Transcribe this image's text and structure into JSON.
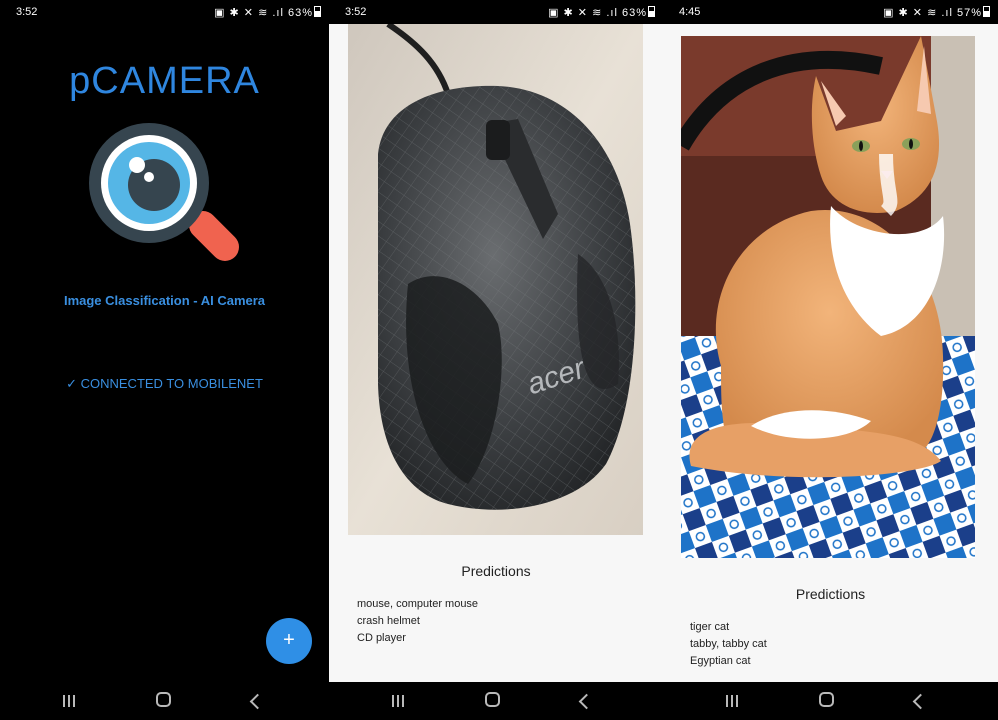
{
  "screens": [
    {
      "status": {
        "time": "3:52",
        "icons": "▣ ✱ ✕ ≋ .ıl",
        "battery": "63%"
      },
      "app_title": "pCAMERA",
      "subtitle": "Image Classification - AI Camera",
      "connected": "✓ CONNECTED TO MOBILENET",
      "fab_label": "+",
      "logo_icon": "magnifier-eye-icon",
      "colors": {
        "accent": "#2f86df",
        "lens": "#55b6e6",
        "handle": "#f0634f",
        "frame": "#36454f"
      }
    },
    {
      "status": {
        "time": "3:52",
        "icons": "▣ ✱ ✕ ≋ .ıl",
        "battery": "63%"
      },
      "photo_subject": "acer computer mouse",
      "photo_brand_text": "acer",
      "predictions_title": "Predictions",
      "predictions": [
        "mouse, computer mouse",
        "crash helmet",
        "CD player"
      ]
    },
    {
      "status": {
        "time": "4:45",
        "icons": "▣ ✱ ✕ ≋ .ıl",
        "battery": "57%"
      },
      "photo_subject": "orange and white cat sitting on blue patterned cloth",
      "predictions_title": "Predictions",
      "predictions": [
        "tiger cat",
        "tabby, tabby cat",
        "Egyptian cat"
      ]
    }
  ],
  "nav": {
    "recent": "recent-apps",
    "home": "home",
    "back": "back"
  }
}
